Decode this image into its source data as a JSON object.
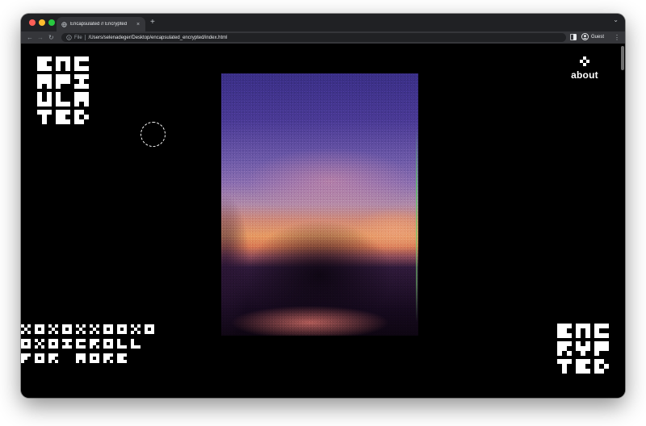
{
  "browser": {
    "tab_title": "Encapsulated // Encrypted",
    "tab_close_icon": "×",
    "new_tab_icon": "+",
    "window_menu_icon": "⌄",
    "address_scheme": "File",
    "address_url": "/Users/selenadeger/Desktop/encapsulated_encrypted/index.html",
    "profile_label": "Guest",
    "back_icon": "←",
    "forward_icon": "→",
    "reload_icon": "↻",
    "menu_icon": "⋮"
  },
  "page": {
    "logo_top_lines": [
      "ENC",
      "APS",
      "ULA",
      "TED"
    ],
    "about_label": "about",
    "scroll_lines": [
      "XOXOXXOOXO",
      "OXOSCROLL",
      "FOR MORE"
    ],
    "logo_bottom_lines": [
      "ENC",
      "RYP",
      "TED"
    ],
    "artwork_name": "encapsulated-artwork"
  },
  "colors": {
    "background": "#000000",
    "text": "#ffffff",
    "chrome_dark": "#202124",
    "chrome_toolbar": "#35363a"
  }
}
